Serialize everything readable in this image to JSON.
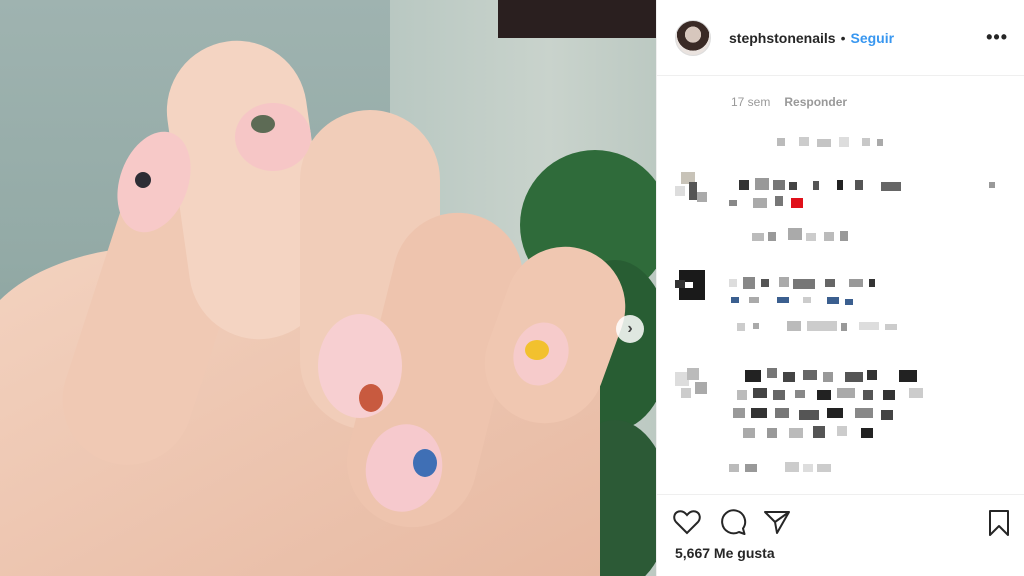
{
  "post": {
    "username": "stephstonenails",
    "separator": "•",
    "follow_label": "Seguir",
    "more_label": "•••"
  },
  "comment": {
    "time": "17 sem",
    "reply_label": "Responder"
  },
  "actions": {
    "likes": "5,667 Me gusta"
  },
  "colors": {
    "accent": "#3897f0",
    "nail_dots": [
      "#2d2d35",
      "#5d6b55",
      "#c85a3f",
      "#3f6fb5",
      "#f2c12e"
    ]
  },
  "icons": [
    "chevron-right-icon",
    "heart-icon",
    "comment-icon",
    "share-icon",
    "bookmark-icon",
    "more-icon"
  ]
}
